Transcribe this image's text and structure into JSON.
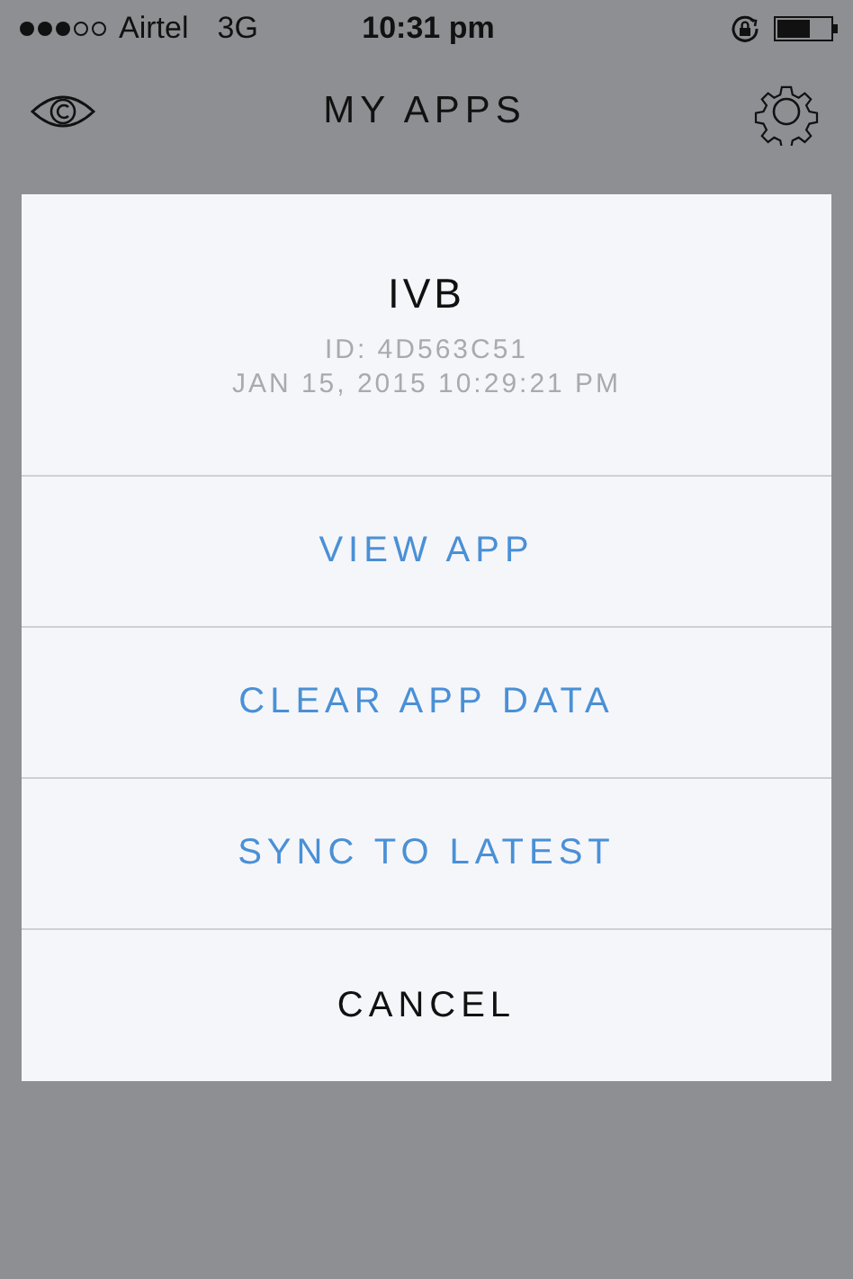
{
  "status_bar": {
    "carrier": "Airtel",
    "network": "3G",
    "time": "10:31 pm"
  },
  "nav_bar": {
    "title": "MY APPS"
  },
  "sheet": {
    "title": "IVB",
    "id": "ID: 4D563C51",
    "date": "JAN 15, 2015 10:29:21 PM",
    "actions": [
      {
        "label": "VIEW APP",
        "kind": "action"
      },
      {
        "label": "CLEAR APP DATA",
        "kind": "action"
      },
      {
        "label": "SYNC TO LATEST",
        "kind": "action"
      },
      {
        "label": "CANCEL",
        "kind": "cancel"
      }
    ]
  }
}
